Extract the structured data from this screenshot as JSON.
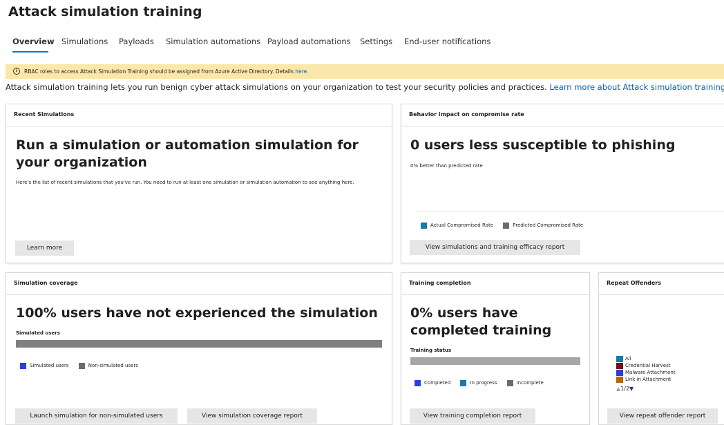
{
  "page": {
    "title": "Attack simulation training"
  },
  "tabs": [
    {
      "label": "Overview",
      "active": true
    },
    {
      "label": "Simulations",
      "active": false
    },
    {
      "label": "Payloads",
      "active": false
    },
    {
      "label": "Simulation automations",
      "active": false
    },
    {
      "label": "Payload automations",
      "active": false
    },
    {
      "label": "Settings",
      "active": false
    },
    {
      "label": "End-user notifications",
      "active": false
    }
  ],
  "notice": {
    "icon": "info-icon",
    "text": "RBAC roles to access Attack Simulation Training should be assigned from Azure Active Directory. Details",
    "link": "here."
  },
  "intro": {
    "text": "Attack simulation training lets you run benign cyber attack simulations on your organization to test your security policies and practices.",
    "link": "Learn more about Attack simulation training"
  },
  "recent_simulations": {
    "title": "Recent Simulations",
    "headline": "Run a simulation or automation simulation for your organization",
    "description": "Here's the list of recent simulations that you've run. You need to run at least one simulation or simulation automation to see anything here.",
    "button": "Learn more"
  },
  "behavior_impact": {
    "title": "Behavior impact on compromise rate",
    "headline": "0 users less susceptible to phishing",
    "subtext": "0% better than predicted rate",
    "legend": [
      {
        "label": "Actual Compromised Rate",
        "color": "#1979a9"
      },
      {
        "label": "Predicted Compromised Rate",
        "color": "#6b6b6b"
      }
    ],
    "button": "View simulations and training efficacy report"
  },
  "simulation_coverage": {
    "title": "Simulation coverage",
    "headline": "100% users have not experienced the simulation",
    "bar_label": "Simulated users",
    "simulated_fraction": 0,
    "legend": [
      {
        "label": "Simulated users",
        "color": "#2b3fd6"
      },
      {
        "label": "Non-simulated users",
        "color": "#6b6b6b"
      }
    ],
    "buttons": [
      "Launch simulation for non-simulated users",
      "View simulation coverage report"
    ]
  },
  "training_completion": {
    "title": "Training completion",
    "headline": "0% users have completed training",
    "bar_label": "Training status",
    "completed_fraction": 0,
    "legend": [
      {
        "label": "Completed",
        "color": "#2b3fd6"
      },
      {
        "label": "In progress",
        "color": "#1979a9"
      },
      {
        "label": "Incomplete",
        "color": "#6b6b6b"
      }
    ],
    "button": "View training completion report"
  },
  "repeat_offenders": {
    "title": "Repeat Offenders",
    "legend": [
      {
        "label": "All",
        "color": "#1979a9"
      },
      {
        "label": "Credential Harvest",
        "color": "#6d0f19"
      },
      {
        "label": "Malware Attachment",
        "color": "#2b3fd6"
      },
      {
        "label": "Link in Attachment",
        "color": "#b5650d"
      }
    ],
    "pager": "1/2",
    "button": "View repeat offender report"
  }
}
